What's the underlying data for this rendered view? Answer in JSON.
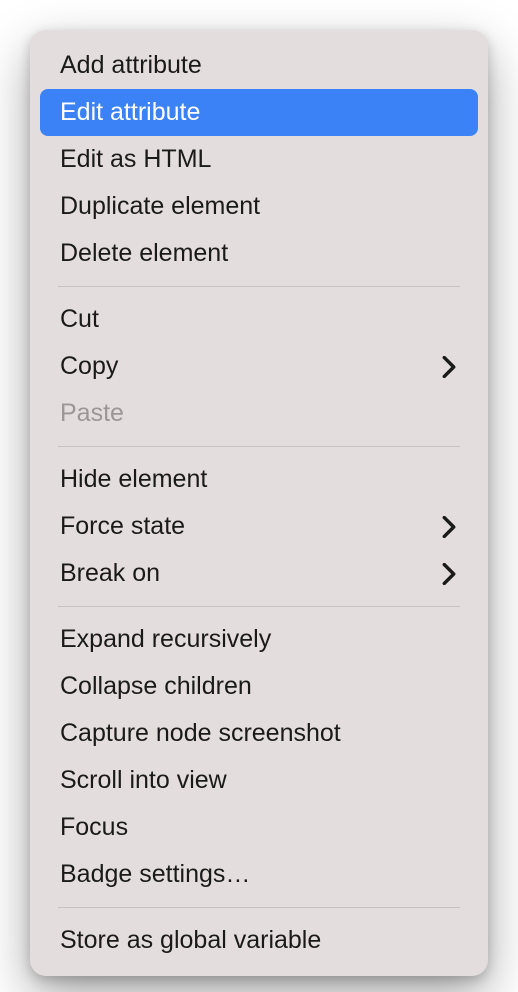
{
  "menu": {
    "sections": [
      {
        "items": [
          {
            "id": "add-attribute",
            "label": "Add attribute",
            "submenu": false,
            "disabled": false,
            "highlighted": false
          },
          {
            "id": "edit-attribute",
            "label": "Edit attribute",
            "submenu": false,
            "disabled": false,
            "highlighted": true
          },
          {
            "id": "edit-as-html",
            "label": "Edit as HTML",
            "submenu": false,
            "disabled": false,
            "highlighted": false
          },
          {
            "id": "duplicate-element",
            "label": "Duplicate element",
            "submenu": false,
            "disabled": false,
            "highlighted": false
          },
          {
            "id": "delete-element",
            "label": "Delete element",
            "submenu": false,
            "disabled": false,
            "highlighted": false
          }
        ]
      },
      {
        "items": [
          {
            "id": "cut",
            "label": "Cut",
            "submenu": false,
            "disabled": false,
            "highlighted": false
          },
          {
            "id": "copy",
            "label": "Copy",
            "submenu": true,
            "disabled": false,
            "highlighted": false
          },
          {
            "id": "paste",
            "label": "Paste",
            "submenu": false,
            "disabled": true,
            "highlighted": false
          }
        ]
      },
      {
        "items": [
          {
            "id": "hide-element",
            "label": "Hide element",
            "submenu": false,
            "disabled": false,
            "highlighted": false
          },
          {
            "id": "force-state",
            "label": "Force state",
            "submenu": true,
            "disabled": false,
            "highlighted": false
          },
          {
            "id": "break-on",
            "label": "Break on",
            "submenu": true,
            "disabled": false,
            "highlighted": false
          }
        ]
      },
      {
        "items": [
          {
            "id": "expand-recursively",
            "label": "Expand recursively",
            "submenu": false,
            "disabled": false,
            "highlighted": false
          },
          {
            "id": "collapse-children",
            "label": "Collapse children",
            "submenu": false,
            "disabled": false,
            "highlighted": false
          },
          {
            "id": "capture-node-screenshot",
            "label": "Capture node screenshot",
            "submenu": false,
            "disabled": false,
            "highlighted": false
          },
          {
            "id": "scroll-into-view",
            "label": "Scroll into view",
            "submenu": false,
            "disabled": false,
            "highlighted": false
          },
          {
            "id": "focus",
            "label": "Focus",
            "submenu": false,
            "disabled": false,
            "highlighted": false
          },
          {
            "id": "badge-settings",
            "label": "Badge settings…",
            "submenu": false,
            "disabled": false,
            "highlighted": false
          }
        ]
      },
      {
        "items": [
          {
            "id": "store-as-global",
            "label": "Store as global variable",
            "submenu": false,
            "disabled": false,
            "highlighted": false
          }
        ]
      }
    ]
  },
  "colors": {
    "menu_bg": "#e4ddde",
    "highlight": "#3b82f6",
    "text": "#1a1a1a",
    "disabled": "#9c9698",
    "separator": "#c7c1c2"
  }
}
